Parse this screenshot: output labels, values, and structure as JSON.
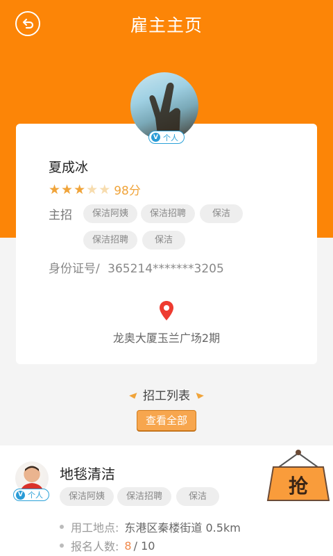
{
  "header": {
    "title": "雇主主页",
    "back_icon": "back-arrow-icon"
  },
  "colors": {
    "brand_orange": "#fc8507",
    "star_gold": "#f0a43a",
    "badge_blue": "#2aa1d8"
  },
  "employer": {
    "name": "夏成冰",
    "badge": "个人",
    "rating": 3,
    "rating_max": 5,
    "score": "98分",
    "hire_label": "主招",
    "tags": [
      "保洁阿姨",
      "保洁招聘",
      "保洁",
      "保洁招聘",
      "保洁"
    ],
    "id_label": "身份证号/",
    "id_value": "365214*******3205",
    "address": "龙奥大厦玉兰广场2期"
  },
  "jobs_section": {
    "title": "招工列表",
    "view_all": "查看全部"
  },
  "job": {
    "title": "地毯清洁",
    "badge": "个人",
    "tags": [
      "保洁阿姨",
      "保洁招聘",
      "保洁"
    ],
    "grab_label": "抢",
    "location_label": "用工地点:",
    "location_value": "东港区秦楼街道  0.5km",
    "signup_label": "报名人数:",
    "signup_count": "8",
    "signup_total": "/ 10"
  }
}
